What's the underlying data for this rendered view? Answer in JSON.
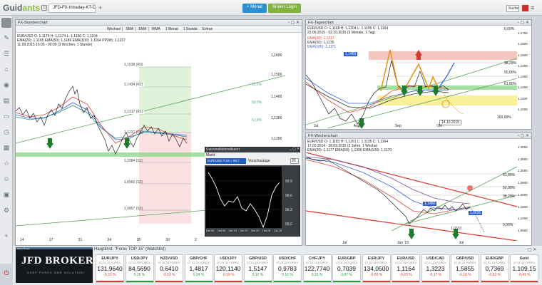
{
  "app": {
    "logo_a": "Guid",
    "logo_b": "ants"
  },
  "topbar": {
    "tabs": [
      "JFD-FX-Intraday-KT-D-W"
    ],
    "buttons": [
      {
        "label": "+ Monat",
        "color": "#2d8fd0"
      },
      {
        "label": "Broker Login",
        "color": "#7fb33d"
      }
    ],
    "search": "Suche"
  },
  "chart1": {
    "title": "FX-Stundenchart",
    "toolbar": [
      "Wechsel",
      "SMA",
      "EMA",
      "WMA",
      "1 Monat",
      "1 Stunde",
      "Extras"
    ],
    "legend1": "EUR/USD   O: 1,1174  H: 1,1174  L: 1,1156  C: 1,1164",
    "legend2": "EMA(20): 1,1165   EMA(50): 1,1186   EMA(100): 1,1164   PP(W): 1,1207",
    "legend3": "11.09.2015 16:00 - 09:00 (3 Wochen, 1 Stunde)",
    "fib_labels": [
      {
        "t": "1,1538 (R3)",
        "y": 92
      },
      {
        "t": "1,1434 (R2)",
        "y": 120
      },
      {
        "t": "1,1317 (R1)",
        "y": 158
      },
      {
        "t": "1,1237 (PP)",
        "y": 187
      },
      {
        "t": "1,1084 (S1)",
        "y": 227
      },
      {
        "t": "1,0960 (S2)",
        "y": 257
      },
      {
        "t": "1,0857 (S3)",
        "y": 294
      }
    ],
    "yticks": [
      {
        "t": "1,1600",
        "y": 77
      },
      {
        "t": "1,1500",
        "y": 104
      },
      {
        "t": "1,1400",
        "y": 135
      },
      {
        "t": "1,1300",
        "y": 165
      },
      {
        "t": "1,1200",
        "y": 194
      }
    ],
    "pct_labels": [
      {
        "t": "23,6%",
        "y": 118
      },
      {
        "t": "50,0%",
        "y": 143
      },
      {
        "t": "61,8%",
        "y": 168
      }
    ],
    "xticks": [
      "14",
      "17",
      "21",
      "24",
      "28",
      "30",
      "2"
    ]
  },
  "chart2": {
    "title": "FX-Tageschart",
    "legend1": "EUR/USD   O: 1,1168  H: 1,1204  L: 1,1155  C: 1,1164",
    "legend2": "22.06.2015 - 02.10.2015 (3 Monate, 1 Tag)",
    "ema": [
      {
        "t": "EMA(20): 1,1217",
        "c": "#e0443a"
      },
      {
        "t": "EMA(50): 1,1135",
        "c": "#333"
      },
      {
        "t": "EMA(100): 1,1171",
        "c": "#3a5fd8"
      }
    ],
    "badge": "1,1455",
    "pct_labels": [
      {
        "t": "0,00%",
        "y": 40
      },
      {
        "t": "38,20%",
        "y": 88
      },
      {
        "t": "50,00%",
        "y": 101
      },
      {
        "t": "61,80%",
        "y": 117
      }
    ],
    "yticks": [
      "1,1700",
      "1,1600",
      "1,1500",
      "1,1400",
      "1,1300",
      "1,1200",
      "1,1100",
      "1,1000"
    ],
    "xticks": [
      "Jul",
      "Aug",
      "Sep",
      "Okt"
    ],
    "date_label": "14.10.2015",
    "pct_100": "100,00%"
  },
  "chart3": {
    "title": "FX-Wochenchart",
    "legend1": "EUR/USD   O: 1,1183  H: 1,1261  L: 1,1135  C: 1,1164",
    "legend2": "17.02.2014 - 28.09.2015 (2 Jahre, 1 Woche)",
    "legend3": "EMA(20): 1,1177  EMA(50): 1,1306  EMA(100): 1,1170",
    "yticks": [
      "1,4000",
      "1,3500",
      "1,3000",
      "1,2500",
      "1,2000",
      "1,1500",
      "1,1000",
      "1,0500"
    ],
    "pct_labels": [
      "61,80%",
      "50,00%",
      "38,20%",
      "0,00%"
    ],
    "xticks": [
      "Jul",
      "Jan '15",
      "Jul"
    ],
    "badges": [
      "1,1460",
      "1,0635",
      "1,0333"
    ]
  },
  "saison": {
    "title": "Saisonalitätsindikator",
    "label": "Markt",
    "symbol": "EUR/USD-T-22 = 99,7",
    "days_label": "Vorschautage",
    "days": "20",
    "yticks": [
      "99,9",
      "99,6",
      "99,3",
      "99,0"
    ],
    "xticks": [
      "Okt 05",
      "Okt 09",
      "Okt 13",
      "Okt 17",
      "Okt 21",
      "Okt 25",
      "Okt 29"
    ]
  },
  "watchlist": {
    "title": "Hauptinst. \"Forex TOP 15\" (Watchlist)",
    "brand": "JFD BROKERS",
    "brand_sub": "DEEP FOREX ONE SOLUTION",
    "left_label": "Wechsel",
    "items": [
      {
        "name": "EUR/JPY",
        "sub": "07.01.15 FOREX",
        "value": "131,9640",
        "change": "-0,23 %",
        "up": false
      },
      {
        "name": "USD/JPY",
        "sub": "07.01.15 FOREX",
        "value": "84,5690",
        "change": "0,28 %",
        "up": true
      },
      {
        "name": "NZD/USD",
        "sub": "07.01.15 FOREX",
        "value": "0,6410",
        "change": "-0,19 %",
        "up": false
      },
      {
        "name": "GBP/CHF",
        "sub": "07.01.15 FOREX",
        "value": "1,4817",
        "change": "0,24 %",
        "up": true
      },
      {
        "name": "USD/JPY",
        "sub": "07.01.15 FOREX",
        "value": "120,1140",
        "change": "-0,19 %",
        "up": false
      },
      {
        "name": "GBP/USD",
        "sub": "07.01.15 FOREX",
        "value": "1,5147",
        "change": "0,12 %",
        "up": true
      },
      {
        "name": "USD/CHF",
        "sub": "07.01.15 FOREX",
        "value": "0,9783",
        "change": "0,15 %",
        "up": true
      },
      {
        "name": "CHF/JPY",
        "sub": "07.01.15 FOREX",
        "value": "122,7740",
        "change": "0,33 %",
        "up": true
      },
      {
        "name": "EUR/GBP",
        "sub": "07.01.15 FOREX",
        "value": "0,7039",
        "change": "0,07 %",
        "up": true
      },
      {
        "name": "EUR/JPY",
        "sub": "07.01.15 FOREX",
        "value": "134,0500",
        "change": "-0,03 %",
        "up": false
      },
      {
        "name": "EUR/USD",
        "sub": "07.01.15 FOREX",
        "value": "1,1164",
        "change": "-0,23 %",
        "up": false
      },
      {
        "name": "USD/CAD",
        "sub": "07.01.15 FOREX",
        "value": "1,3223",
        "change": "-0,17 %",
        "up": false
      },
      {
        "name": "GBP/USD",
        "sub": "07.01.15 FOREX",
        "value": "1,5855",
        "change": "-0,16 %",
        "up": false
      },
      {
        "name": "EUR/GBP",
        "sub": "07.01.15 FOREX",
        "value": "0,7369",
        "change": "-0,62 %",
        "up": false
      },
      {
        "name": "Gold",
        "sub": "07.01.15 FOREX",
        "value": "1.109,15",
        "change": "-0,41 %",
        "up": false
      }
    ]
  }
}
